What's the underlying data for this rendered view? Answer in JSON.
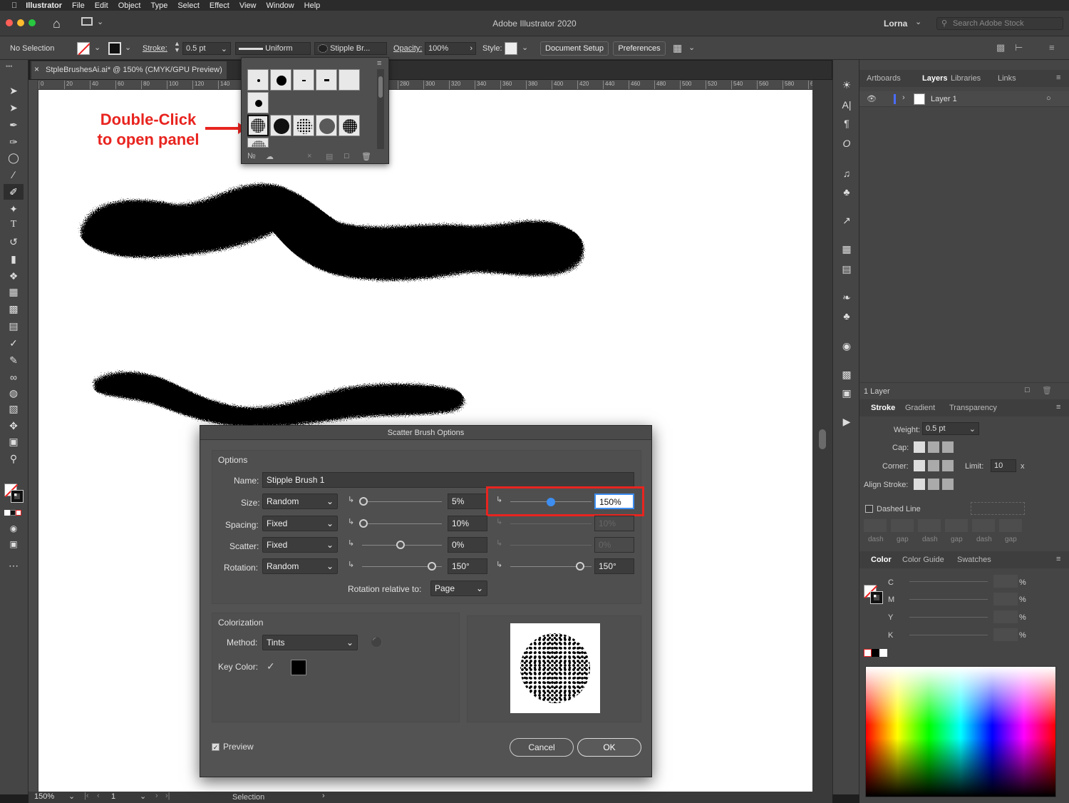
{
  "menubar": {
    "app": "Illustrator",
    "items": [
      "File",
      "Edit",
      "Object",
      "Type",
      "Select",
      "Effect",
      "View",
      "Window",
      "Help"
    ]
  },
  "titlebar": {
    "title": "Adobe Illustrator 2020",
    "user": "Lorna",
    "search_placeholder": "Search Adobe Stock"
  },
  "control": {
    "selection": "No Selection",
    "stroke_label": "Stroke:",
    "stroke_value": "0.5 pt",
    "profile": "Uniform",
    "brush": "Stipple Br...",
    "opacity_label": "Opacity:",
    "opacity_value": "100%",
    "style_label": "Style:",
    "doc_setup": "Document Setup",
    "preferences": "Preferences"
  },
  "document_tab": {
    "title": "StpleBrushesAi.ai* @ 150% (CMYK/GPU Preview)"
  },
  "ruler_ticks": [
    "0",
    "20",
    "40",
    "60",
    "80",
    "100",
    "120",
    "140",
    "",
    "",
    "",
    "",
    "",
    "",
    "280",
    "300",
    "320",
    "340",
    "360",
    "380",
    "400",
    "420",
    "440",
    "460",
    "480",
    "500",
    "520",
    "540",
    "560",
    "580",
    "600"
  ],
  "annotation": {
    "line1": "Double-Click",
    "line2": "to open panel",
    "color": "#e8241f"
  },
  "dialog": {
    "title": "Scatter Brush Options",
    "options_label": "Options",
    "name_label": "Name:",
    "name_value": "Stipple Brush 1",
    "rows": [
      {
        "label": "Size:",
        "method": "Random",
        "v1": "5%",
        "v2": "150%"
      },
      {
        "label": "Spacing:",
        "method": "Fixed",
        "v1": "10%",
        "v2": "10%"
      },
      {
        "label": "Scatter:",
        "method": "Fixed",
        "v1": "0%",
        "v2": "0%"
      },
      {
        "label": "Rotation:",
        "method": "Random",
        "v1": "150°",
        "v2": "150°"
      }
    ],
    "rotation_relative_label": "Rotation relative to:",
    "rotation_relative_value": "Page",
    "colorization_label": "Colorization",
    "method_label": "Method:",
    "method_value": "Tints",
    "key_color_label": "Key Color:",
    "preview_label": "Preview",
    "cancel": "Cancel",
    "ok": "OK",
    "highlight_color": "#e8241f"
  },
  "layers_panel": {
    "tabs": [
      "Artboards",
      "Layers",
      "Libraries",
      "Links"
    ],
    "layer_name": "Layer 1",
    "footer": "1 Layer"
  },
  "stroke_panel": {
    "tabs": [
      "Stroke",
      "Gradient",
      "Transparency"
    ],
    "weight_label": "Weight:",
    "weight_value": "0.5 pt",
    "cap_label": "Cap:",
    "corner_label": "Corner:",
    "limit_label": "Limit:",
    "limit_value": "10",
    "limit_x": "x",
    "align_label": "Align Stroke:",
    "dashed_label": "Dashed Line",
    "dash_labels": [
      "dash",
      "gap",
      "dash",
      "gap",
      "dash",
      "gap"
    ]
  },
  "color_panel": {
    "tabs": [
      "Color",
      "Color Guide",
      "Swatches"
    ],
    "channels": [
      "C",
      "M",
      "Y",
      "K"
    ],
    "pct": "%"
  },
  "status": {
    "zoom": "150%",
    "artboard": "1",
    "mode": "Selection"
  }
}
